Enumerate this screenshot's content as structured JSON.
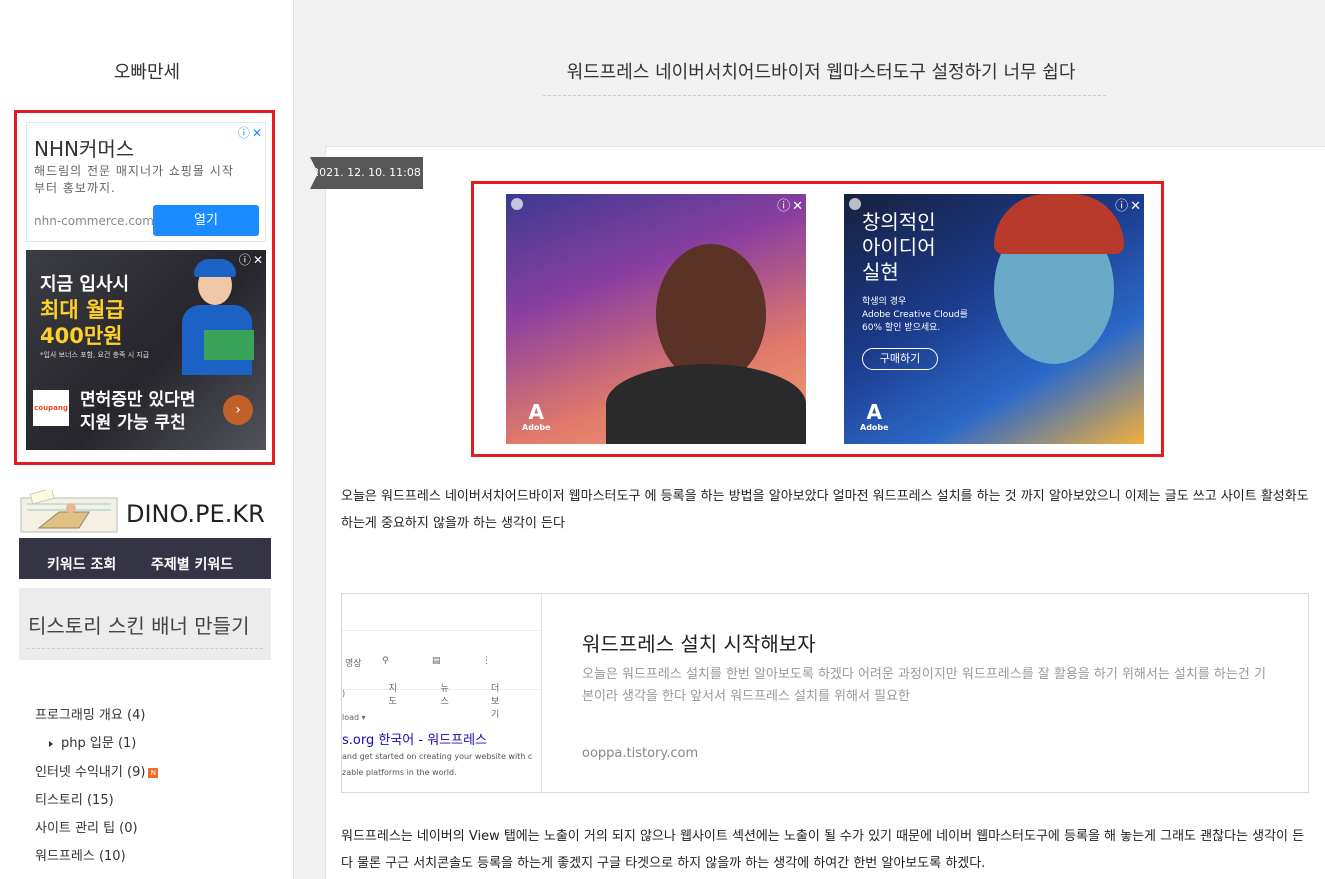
{
  "sidebar": {
    "blog_title": "오빠만세",
    "ad1": {
      "title": "NHN커머스",
      "desc": "해드림의 전문 매지너가 쇼핑몰 시작부터 홍보까지.",
      "domain": "nhn-commerce.com",
      "button": "열기"
    },
    "ad2": {
      "line1": "지금 입사시",
      "line2": "최대 월급",
      "line3": "400만원",
      "note": "*입사 보너스 포함, 요건 충족 시 지급",
      "logo": "coupang",
      "bottom1": "면허증만 있다면",
      "bottom2": "지원 가능 쿠친",
      "arrow": "›"
    },
    "ad_info_icon": "ⓘ",
    "ad_close_icon": "✕",
    "dino": {
      "name": "DINO.PE.KR",
      "nav": [
        "키워드 조회",
        "주제별 키워드"
      ]
    },
    "tistory_banner": "티스토리 스킨 배너 만들기",
    "categories": [
      {
        "label": "프로그래밍 개요",
        "count": "(4)"
      },
      {
        "label": "php 입문",
        "count": "(1)"
      },
      {
        "label": "인터넷 수익내기",
        "count": "(9)",
        "badge": "N"
      },
      {
        "label": "티스토리",
        "count": "(15)"
      },
      {
        "label": "사이트 관리 팁",
        "count": "(0)"
      },
      {
        "label": "워드프레스",
        "count": "(10)"
      }
    ]
  },
  "post": {
    "title": "워드프레스 네이버서치어드바이저 웹마스터도구 설정하기 너무 쉽다",
    "date": "2021. 12. 10. 11:08",
    "adobe_ad": {
      "logo": "Adobe",
      "headline": "창의적인\n아이디어\n실현",
      "sub": "학생의 경우\nAdobe Creative Cloud를\n60% 할인 받으세요.",
      "button": "구매하기"
    },
    "para1": "오늘은 워드프레스 네이버서치어드바이저 웹마스터도구  에 등록을 하는 방법을 알아보았다 얼마전 워드프레스 설치를 하는 것 까지 알아보았으니 이제는 글도 쓰고 사이트 활성화도 하는게 중요하지 않을까 하는 생각이 든다",
    "link_card": {
      "title": "워드프레스 설치 시작해보자",
      "desc": "오늘은 워드프레스 설치를 한번 알아보도록 하겠다 어려운 과정이지만 워드프레스를 잘 활용을 하기 위해서는 설치를 하는건 기본이라 생각을 한다 앞서서 워드프레스 설치를 위해서 필요한",
      "url": "ooppa.tistory.com",
      "thumb": {
        "tabs": [
          "영상",
          "지도",
          "뉴스",
          "더보기"
        ],
        "t1": ")",
        "t2": "load ▾",
        "t3": "s.org 한국어 - 워드프레스",
        "t4": "and get started on creating your website with c",
        "t5": "zable platforms in the world."
      }
    },
    "para2": "워드프레스는 네이버의 View 탭에는 노출이 거의 되지 않으나 웹사이트 섹션에는 노출이 될 수가 있기 때문에 네이버 웹마스터도구에 등록을 해 놓는게 그래도 괜찮다는 생각이 든다 물론 구근 서치콘솔도 등록을 하는게 좋겠지 구글 타겟으로 하지 않을까 하는 생각에 하여간 한번 알아보도록 하겠다."
  }
}
